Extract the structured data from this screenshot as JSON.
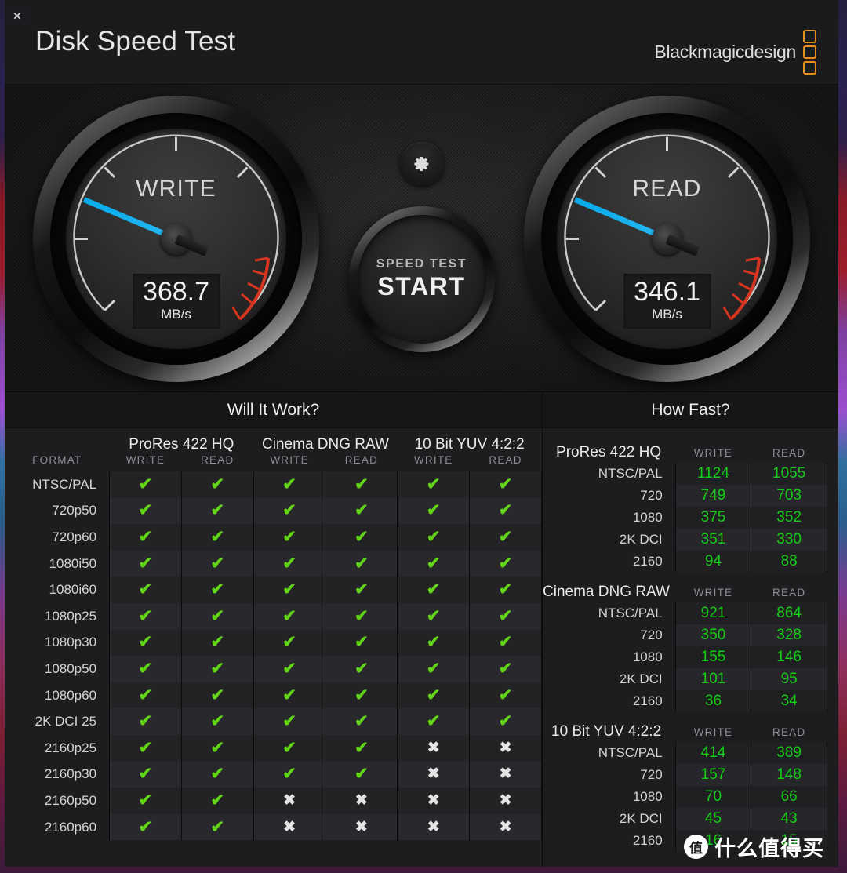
{
  "window": {
    "title": "Disk Speed Test",
    "close_label": "✕",
    "brand": {
      "name": "Blackmagicdesign",
      "accent_color": "#e8901c"
    }
  },
  "gauges": {
    "write": {
      "label": "WRITE",
      "value": "368.7",
      "unit": "MB/s",
      "needle_color": "#0fb0ee",
      "angle_deg": 203
    },
    "read": {
      "label": "READ",
      "value": "346.1",
      "unit": "MB/s",
      "needle_color": "#0fb0ee",
      "angle_deg": 203
    }
  },
  "controls": {
    "gear_icon": "gear-icon",
    "start_small_label": "SPEED TEST",
    "start_big_label": "START"
  },
  "will_it_work": {
    "title": "Will It Work?",
    "format_header": "FORMAT",
    "groups": [
      "ProRes 422 HQ",
      "Cinema DNG RAW",
      "10 Bit YUV 4:2:2"
    ],
    "sub_headers": [
      "WRITE",
      "READ"
    ],
    "ok_glyph": "✔",
    "no_glyph": "✖",
    "ok_color": "#62d518",
    "no_color": "#e4e4e4",
    "rows": [
      {
        "format": "NTSC/PAL",
        "cells": [
          true,
          true,
          true,
          true,
          true,
          true
        ]
      },
      {
        "format": "720p50",
        "cells": [
          true,
          true,
          true,
          true,
          true,
          true
        ]
      },
      {
        "format": "720p60",
        "cells": [
          true,
          true,
          true,
          true,
          true,
          true
        ]
      },
      {
        "format": "1080i50",
        "cells": [
          true,
          true,
          true,
          true,
          true,
          true
        ]
      },
      {
        "format": "1080i60",
        "cells": [
          true,
          true,
          true,
          true,
          true,
          true
        ]
      },
      {
        "format": "1080p25",
        "cells": [
          true,
          true,
          true,
          true,
          true,
          true
        ]
      },
      {
        "format": "1080p30",
        "cells": [
          true,
          true,
          true,
          true,
          true,
          true
        ]
      },
      {
        "format": "1080p50",
        "cells": [
          true,
          true,
          true,
          true,
          true,
          true
        ]
      },
      {
        "format": "1080p60",
        "cells": [
          true,
          true,
          true,
          true,
          true,
          true
        ]
      },
      {
        "format": "2K DCI 25",
        "cells": [
          true,
          true,
          true,
          true,
          true,
          true
        ]
      },
      {
        "format": "2160p25",
        "cells": [
          true,
          true,
          true,
          true,
          false,
          false
        ]
      },
      {
        "format": "2160p30",
        "cells": [
          true,
          true,
          true,
          true,
          false,
          false
        ]
      },
      {
        "format": "2160p50",
        "cells": [
          true,
          true,
          false,
          false,
          false,
          false
        ]
      },
      {
        "format": "2160p60",
        "cells": [
          true,
          true,
          false,
          false,
          false,
          false
        ]
      }
    ]
  },
  "how_fast": {
    "title": "How Fast?",
    "sub_headers": [
      "WRITE",
      "READ"
    ],
    "value_color": "#15cc15",
    "groups": [
      {
        "name": "ProRes 422 HQ",
        "rows": [
          {
            "resolution": "NTSC/PAL",
            "write": "1124",
            "read": "1055"
          },
          {
            "resolution": "720",
            "write": "749",
            "read": "703"
          },
          {
            "resolution": "1080",
            "write": "375",
            "read": "352"
          },
          {
            "resolution": "2K DCI",
            "write": "351",
            "read": "330"
          },
          {
            "resolution": "2160",
            "write": "94",
            "read": "88"
          }
        ]
      },
      {
        "name": "Cinema DNG RAW",
        "rows": [
          {
            "resolution": "NTSC/PAL",
            "write": "921",
            "read": "864"
          },
          {
            "resolution": "720",
            "write": "350",
            "read": "328"
          },
          {
            "resolution": "1080",
            "write": "155",
            "read": "146"
          },
          {
            "resolution": "2K DCI",
            "write": "101",
            "read": "95"
          },
          {
            "resolution": "2160",
            "write": "36",
            "read": "34"
          }
        ]
      },
      {
        "name": "10 Bit YUV 4:2:2",
        "rows": [
          {
            "resolution": "NTSC/PAL",
            "write": "414",
            "read": "389"
          },
          {
            "resolution": "720",
            "write": "157",
            "read": "148"
          },
          {
            "resolution": "1080",
            "write": "70",
            "read": "66"
          },
          {
            "resolution": "2K DCI",
            "write": "45",
            "read": "43"
          },
          {
            "resolution": "2160",
            "write": "16",
            "read": "15"
          }
        ]
      }
    ]
  },
  "watermark": {
    "badge": "值",
    "text": "什么值得买"
  }
}
